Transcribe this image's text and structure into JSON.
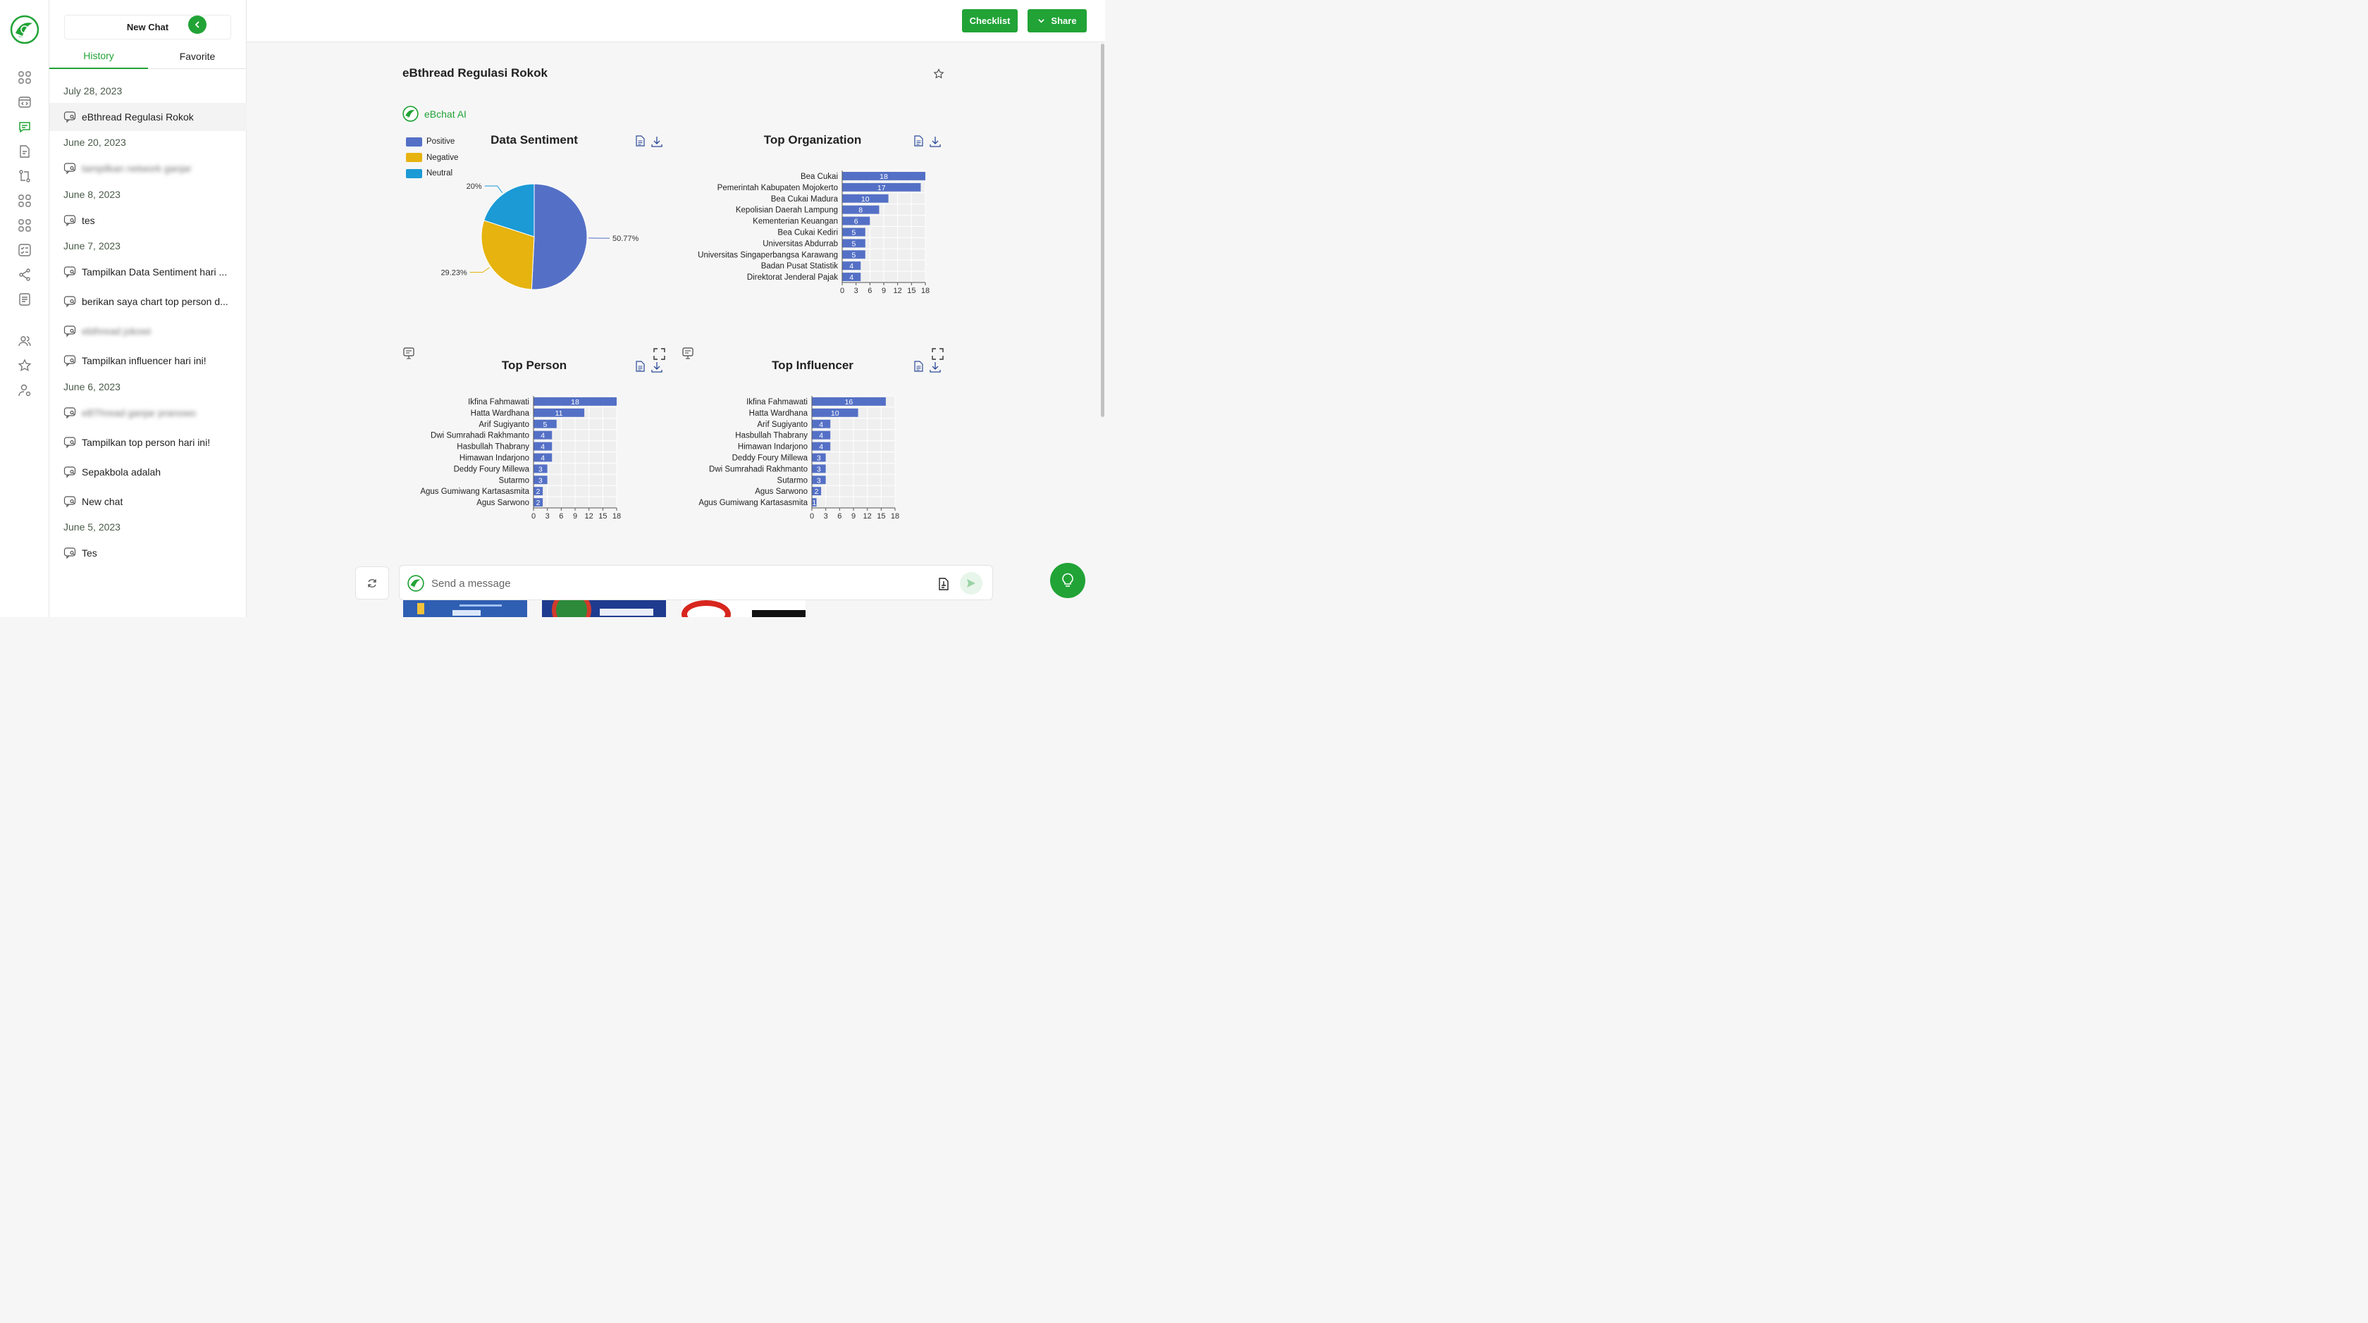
{
  "sidebar": {
    "new_chat_label": "New Chat",
    "tabs": [
      "History",
      "Favorite"
    ],
    "groups": [
      {
        "date": "July 28, 2023",
        "items": [
          "eBthread Regulasi Rokok"
        ]
      },
      {
        "date": "June 20, 2023",
        "items": [
          "tampilkan network ganjar"
        ]
      },
      {
        "date": "June 8, 2023",
        "items": [
          "tes"
        ]
      },
      {
        "date": "June 7, 2023",
        "items": [
          "Tampilkan Data Sentiment hari ...",
          "berikan saya chart top person d...",
          "ebthread jokowi",
          "Tampilkan influencer hari ini!"
        ]
      },
      {
        "date": "June 6, 2023",
        "items": [
          "eBThread ganjar pranowo",
          "Tampilkan top person hari ini!",
          "Sepakbola adalah",
          "New chat"
        ]
      },
      {
        "date": "June 5, 2023",
        "items": [
          "Tes"
        ]
      }
    ]
  },
  "header": {
    "checklist_label": "Checklist",
    "share_label": "Share"
  },
  "main": {
    "title": "eBthread Regulasi Rokok",
    "bot_name": "eBchat AI"
  },
  "input": {
    "placeholder": "Send a message"
  },
  "colors": {
    "accent": "#21a336",
    "bar": "#5470c6",
    "positive": "#5470c6",
    "negative": "#e6b30f",
    "neutral": "#1b9ad6"
  },
  "chart_data": [
    {
      "type": "pie",
      "title": "Data Sentiment",
      "legend_position": "top-left",
      "labels": [
        "Positive",
        "Negative",
        "Neutral"
      ],
      "values": [
        50.77,
        29.23,
        20
      ],
      "data_labels": [
        "50.77%",
        "29.23%",
        "20%"
      ]
    },
    {
      "type": "bar",
      "orientation": "horizontal",
      "title": "Top Organization",
      "categories": [
        "Bea Cukai",
        "Pemerintah Kabupaten Mojokerto",
        "Bea Cukai Madura",
        "Kepolisian Daerah Lampung",
        "Kementerian Keuangan",
        "Bea Cukai Kediri",
        "Universitas Abdurrab",
        "Universitas Singaperbangsa Karawang",
        "Badan Pusat Statistik",
        "Direktorat Jenderal Pajak"
      ],
      "values": [
        18,
        17,
        10,
        8,
        6,
        5,
        5,
        5,
        4,
        4
      ],
      "xlim": [
        0,
        18
      ],
      "xticks": [
        0,
        3,
        6,
        9,
        12,
        15,
        18
      ]
    },
    {
      "type": "bar",
      "orientation": "horizontal",
      "title": "Top Person",
      "categories": [
        "Ikfina Fahmawati",
        "Hatta Wardhana",
        "Arif Sugiyanto",
        "Dwi Sumrahadi Rakhmanto",
        "Hasbullah Thabrany",
        "Himawan Indarjono",
        "Deddy Foury Millewa",
        "Sutarmo",
        "Agus Gumiwang Kartasasmita",
        "Agus Sarwono"
      ],
      "values": [
        18,
        11,
        5,
        4,
        4,
        4,
        3,
        3,
        2,
        2
      ],
      "xlim": [
        0,
        18
      ],
      "xticks": [
        0,
        3,
        6,
        9,
        12,
        15,
        18
      ]
    },
    {
      "type": "bar",
      "orientation": "horizontal",
      "title": "Top Influencer",
      "categories": [
        "Ikfina Fahmawati",
        "Hatta Wardhana",
        "Arif Sugiyanto",
        "Hasbullah Thabrany",
        "Himawan Indarjono",
        "Deddy Foury Millewa",
        "Dwi Sumrahadi Rakhmanto",
        "Sutarmo",
        "Agus Sarwono",
        "Agus Gumiwang Kartasasmita"
      ],
      "values": [
        16,
        10,
        4,
        4,
        4,
        3,
        3,
        3,
        2,
        1
      ],
      "xlim": [
        0,
        18
      ],
      "xticks": [
        0,
        3,
        6,
        9,
        12,
        15,
        18
      ]
    }
  ]
}
